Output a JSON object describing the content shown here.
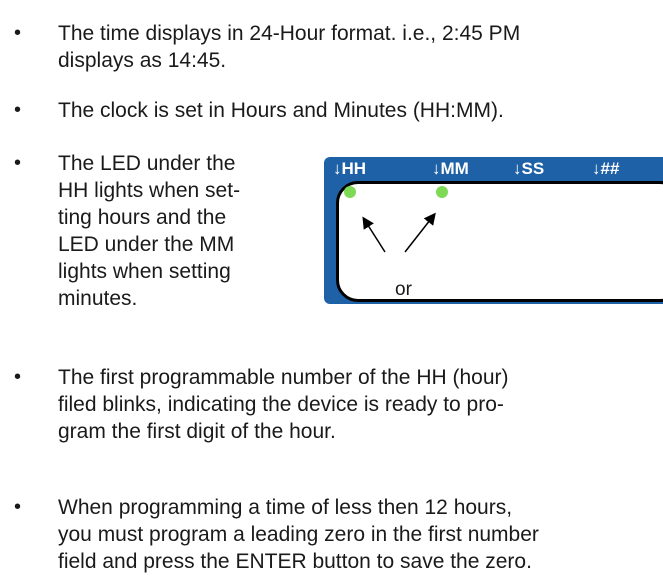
{
  "bullets": [
    "The time displays in 24-Hour format. i.e., 2:45 PM\ndisplays as 14:45.",
    "The clock is set in Hours and Minutes (HH:MM).",
    "The LED under the\nHH lights when set-\nting hours and the\nLED under the MM\nlights when setting\nminutes.",
    "The first programmable number of the HH (hour)\nfiled blinks, indicating the device is ready to pro-\ngram the first digit of the hour.",
    "When programming a time of less then 12 hours,\nyou must program a leading zero in the first number\nfield and press the ENTER button to save the zero."
  ],
  "bullet_glyph": "•",
  "display": {
    "labels": [
      "HH",
      "MM",
      "SS",
      "##"
    ],
    "or_text": "or",
    "colors": {
      "panel": "#1f61a6",
      "led": "#7ed957"
    }
  }
}
